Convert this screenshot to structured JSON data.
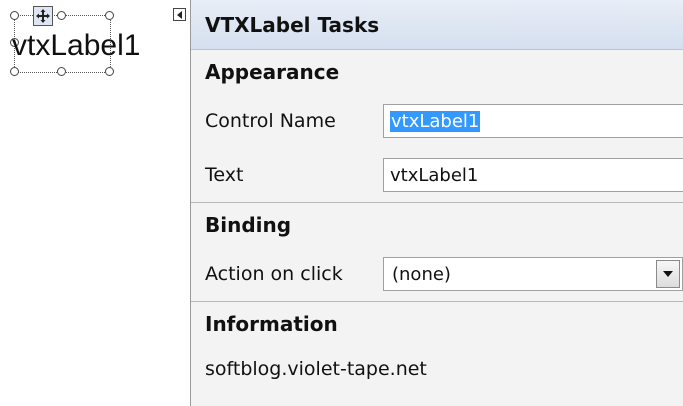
{
  "designer": {
    "label_text": "vtxLabel1"
  },
  "panel": {
    "title": "VTXLabel Tasks",
    "sections": {
      "appearance": "Appearance",
      "binding": "Binding",
      "information": "Information"
    },
    "fields": {
      "control_name_label": "Control Name",
      "control_name_value": "vtxLabel1",
      "text_label": "Text",
      "text_value": "vtxLabel1",
      "action_label": "Action on click",
      "action_value": "(none)"
    },
    "info": "softblog.violet-tape.net"
  },
  "colors": {
    "selection": "#3399ff",
    "header_gradient_top": "#e8eef7",
    "header_gradient_bottom": "#d5dfef"
  },
  "icons": [
    "move-handle-icon",
    "smart-tag-arrow-icon",
    "dropdown-arrow-icon"
  ]
}
